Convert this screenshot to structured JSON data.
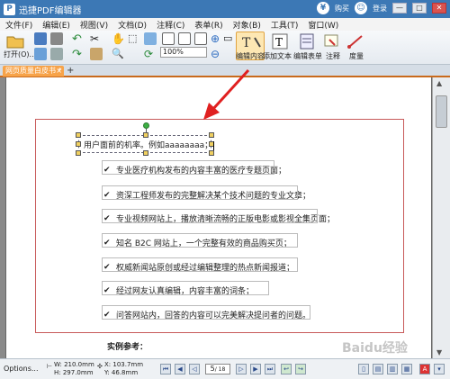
{
  "title_bar": {
    "app_title": "迅捷PDF编辑器",
    "account_label": "购买",
    "account2_label": "登录",
    "minimize": "—",
    "maximize": "□",
    "close": "✕"
  },
  "menu": {
    "items": [
      "文件(F)",
      "编辑(E)",
      "视图(V)",
      "文档(D)",
      "注释(C)",
      "表单(R)",
      "对象(B)",
      "工具(T)",
      "窗口(W)"
    ]
  },
  "toolbar": {
    "open_label": "打开(O)...",
    "zoom_value": "100%",
    "edit_content_label": "编辑内容",
    "add_text_label": "添加文本",
    "edit_form_label": "编辑表单",
    "annotate_label": "注释",
    "measure_label": "度量"
  },
  "tabs": {
    "active_tab": "网页质量白皮书 *",
    "close_symbol": "×",
    "add_symbol": "+"
  },
  "document": {
    "selected_text": "用户面前的机率。例如aaaaaaaa；",
    "list_items": [
      "专业医疗机构发布的内容丰富的医疗专题页面；",
      "资深工程师发布的完整解决某个技术问题的专业文章；",
      "专业视频网站上，播放清晰流畅的正版电影或影视全集页面；",
      "知名 B2C 网站上，一个完整有效的商品购买页；",
      "权威新闻站原创或经过编辑整理的热点新闻报道；",
      "经过网友认真编辑，内容丰富的词条；",
      "问答网站内，回答的内容可以完美解决提问者的问题。"
    ],
    "check_symbol": "✔",
    "reference_label": "实例参考："
  },
  "status_bar": {
    "options_label": "Options...",
    "width_label": "W: 210.0mm",
    "height_label": "H: 297.0mm",
    "x_label": "X: 103.7mm",
    "y_label": "Y: 46.8mm",
    "page_current": "5",
    "page_total": "/ 18"
  },
  "watermark": "Baidu经验",
  "colors": {
    "titlebar": "#3c78b5",
    "tab_active": "#f7a349",
    "arrow": "#e02020",
    "frame": "#c85a5a"
  }
}
